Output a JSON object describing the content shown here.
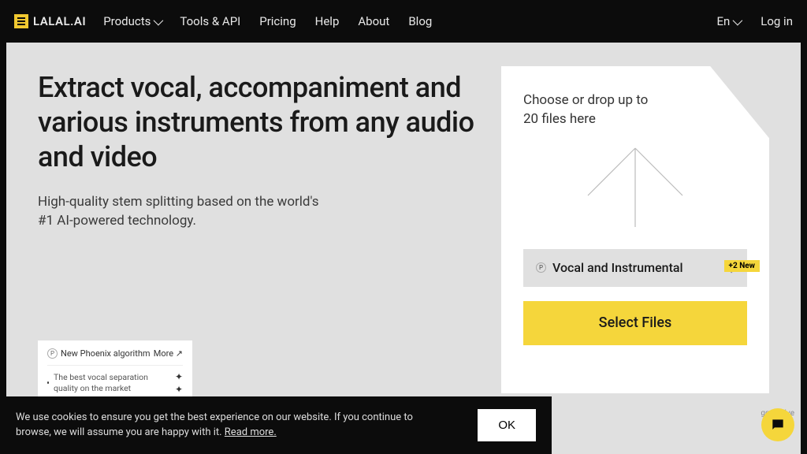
{
  "header": {
    "logo_text": "LALAL.AI",
    "nav": {
      "products": "Products",
      "tools": "Tools & API",
      "pricing": "Pricing",
      "help": "Help",
      "about": "About",
      "blog": "Blog"
    },
    "language": "En",
    "login": "Log in"
  },
  "hero": {
    "headline": "Extract vocal, accompaniment and various instruments from any audio and video",
    "subheadline": "High-quality stem splitting based on the world's #1 AI-powered technology."
  },
  "promo": {
    "title": "New Phoenix algorithm",
    "more": "More ↗",
    "body": "The best vocal separation quality on the market"
  },
  "upload": {
    "drop_text": "Choose or drop up to 20 files here",
    "new_badge": "+2 New",
    "dropdown_label": "Vocal and Instrumental",
    "select_button": "Select Files",
    "aggressive_label": "ggressive"
  },
  "cookie": {
    "text_part1": "We use cookies to ensure you get the best experience on our website. If you continue to browse, we will assume you are happy with it. ",
    "read_more": "Read more.",
    "ok": "OK"
  }
}
